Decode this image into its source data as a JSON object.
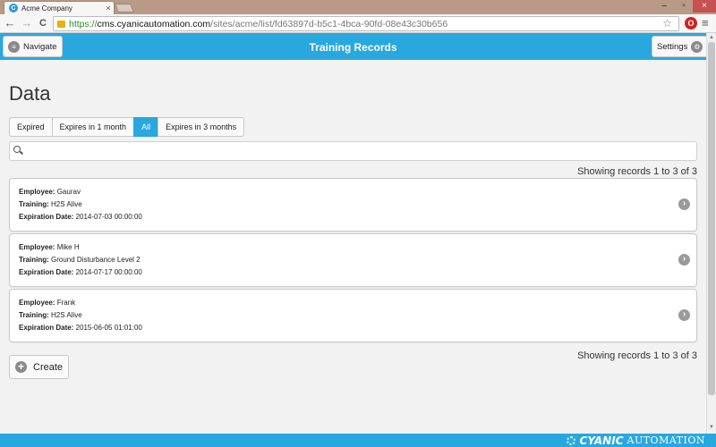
{
  "browser": {
    "tab_title": "Acme Company",
    "tab_favicon": "C",
    "tab_close": "×",
    "url_scheme": "https://",
    "url_host": "cms.cyanicautomation.com",
    "url_path": "/sites/acme/list/fd63897d-b5c1-4bca-90fd-08e43c30b656",
    "back": "←",
    "forward": "→",
    "reload": "C",
    "star": "☆",
    "extension": "O",
    "menu": "≡",
    "minimize": "–",
    "maximize": "▫",
    "close": "×"
  },
  "header": {
    "navigate_label": "Navigate",
    "title": "Training Records",
    "settings_label": "Settings"
  },
  "main": {
    "heading": "Data",
    "filters": [
      {
        "label": "Expired",
        "active": false
      },
      {
        "label": "Expires in 1 month",
        "active": false
      },
      {
        "label": "All",
        "active": true
      },
      {
        "label": "Expires in 3 months",
        "active": false
      }
    ],
    "search": {
      "placeholder": "",
      "value": ""
    },
    "showing_text": "Showing records 1 to 3 of 3",
    "field_labels": {
      "employee": "Employee:",
      "training": "Training:",
      "expiration": "Expiration Date:"
    },
    "records": [
      {
        "employee": "Gaurav",
        "training": "H2S Alive",
        "expiration": "2014-07-03 00:00:00"
      },
      {
        "employee": "Mike H",
        "training": "Ground Disturbance Level 2",
        "expiration": "2014-07-17 00:00:00"
      },
      {
        "employee": "Frank",
        "training": "H2S Alive",
        "expiration": "2015-06-05 01:01:00"
      }
    ],
    "create_label": "Create"
  },
  "footer": {
    "brand_name": "CYANIC",
    "brand_sub": "AUTOMATION"
  },
  "icons": {
    "navigate": "menu-icon",
    "settings": "gear-icon",
    "record_open": "chevron-right-icon",
    "create": "plus-icon",
    "search": "search-icon"
  },
  "colors": {
    "accent": "#29a8e0",
    "active_filter": "#29a8e0"
  }
}
